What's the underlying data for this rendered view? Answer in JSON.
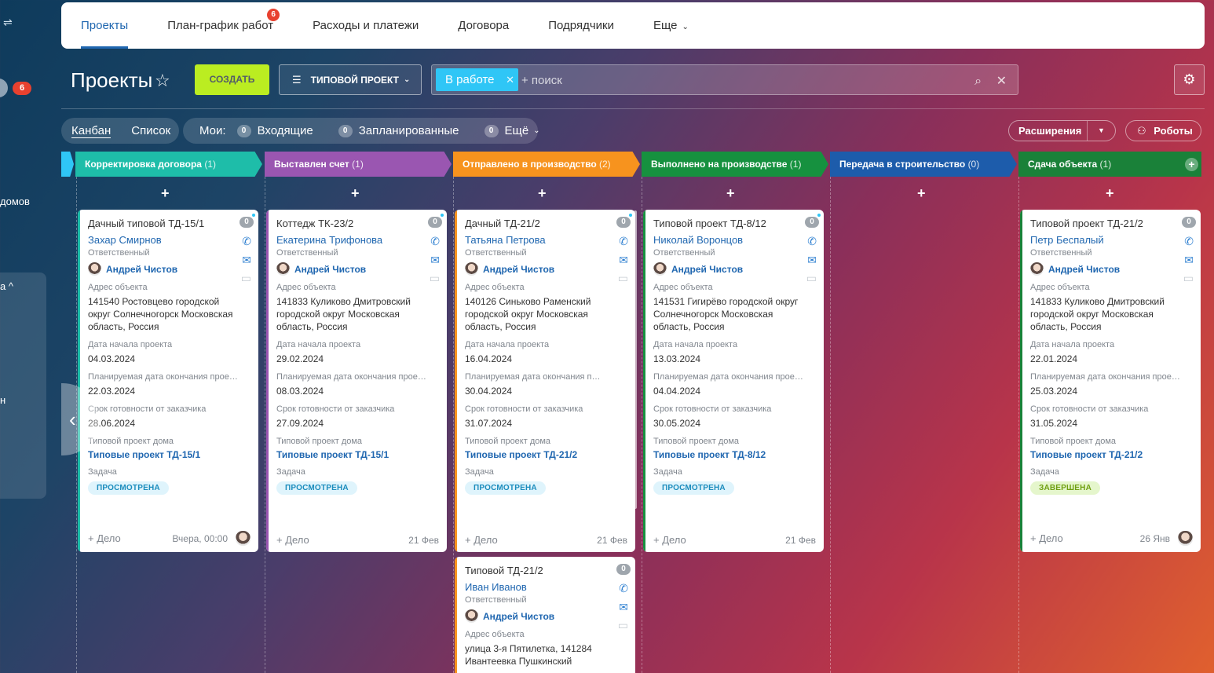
{
  "left_strip": {
    "badge": "6",
    "text1": "домов",
    "text2": "а ^",
    "text3": "н"
  },
  "topnav": {
    "tabs": [
      {
        "label": "Проекты",
        "active": true
      },
      {
        "label": "План-график работ",
        "badge": "6"
      },
      {
        "label": "Расходы и платежи"
      },
      {
        "label": "Договора"
      },
      {
        "label": "Подрядчики"
      },
      {
        "label": "Еще"
      }
    ]
  },
  "toolbar": {
    "title": "Проекты",
    "create_label": "СОЗДАТЬ",
    "preset_label": "ТИПОВОЙ ПРОЕКТ",
    "filter_chip": "В работе",
    "search_placeholder": "+ поиск"
  },
  "views": {
    "kanban": "Канбан",
    "list": "Список"
  },
  "counters": {
    "mine": "Мои:",
    "items": [
      {
        "count": "0",
        "label": "Входящие"
      },
      {
        "count": "0",
        "label": "Запланированные"
      },
      {
        "count": "0",
        "label": "Ещё"
      }
    ]
  },
  "right_buttons": {
    "extensions": "Расширения",
    "robots": "Роботы"
  },
  "stages": [
    {
      "name": "Корректировка договора",
      "count": "(1)",
      "color": "#1ebda9"
    },
    {
      "name": "Выставлен счет",
      "count": "(1)",
      "color": "#9a56b1"
    },
    {
      "name": "Отправлено в производство",
      "count": "(2)",
      "color": "#f7931e"
    },
    {
      "name": "Выполнено на производстве",
      "count": "(1)",
      "color": "#16913f"
    },
    {
      "name": "Передача в строительство",
      "count": "(0)",
      "color": "#1d5cab"
    },
    {
      "name": "Сдача объекта",
      "count": "(1)",
      "color": "#1a8139"
    }
  ],
  "labels": {
    "responsible": "Ответственный",
    "address": "Адрес объекта",
    "start": "Дата начала проекта",
    "planned_end": "Планируемая дата окончания проекта",
    "deadline": "Срок готовности от заказчика",
    "house": "Типовой проект дома",
    "task": "Задача",
    "add_deal": "+ Дело"
  },
  "cards": [
    {
      "title": "Дачный типовой ТД-15/1",
      "client": "Захар Смирнов",
      "responsible": "Андрей Чистов",
      "address": "141540 Ростовцево городской округ Солнечногорск Московская область, Россия",
      "start": "04.03.2024",
      "planned_end": "22.03.2024",
      "deadline": "28.06.2024",
      "house": "Типовые проект ТД-15/1",
      "task": "ПРОСМОТРЕНА",
      "date": "Вчера, 00:00",
      "badge": "0"
    },
    {
      "title": "Коттедж ТК-23/2",
      "client": "Екатерина Трифонова",
      "responsible": "Андрей Чистов",
      "address": "141833 Куликово Дмитровский городской округ Московская область, Россия",
      "start": "29.02.2024",
      "planned_end": "08.03.2024",
      "deadline": "27.09.2024",
      "house": "Типовые проект ТД-15/1",
      "task": "ПРОСМОТРЕНА",
      "date": "21 Фев",
      "badge": "0"
    },
    {
      "title": "Дачный ТД-21/2",
      "client": "Татьяна Петрова",
      "responsible": "Андрей Чистов",
      "address": "140126 Синьково Раменский городской округ Московская область, Россия",
      "start": "16.04.2024",
      "planned_end": "30.04.2024",
      "deadline": "31.07.2024",
      "house": "Типовые проект ТД-21/2",
      "task": "ПРОСМОТРЕНА",
      "date": "21 Фев",
      "badge": "0"
    },
    {
      "title": "Типовой проект ТД-8/12",
      "client": "Николай Воронцов",
      "responsible": "Андрей Чистов",
      "address": "141531 Гигирёво городской округ Солнечногорск Московская область, Россия",
      "start": "13.03.2024",
      "planned_end": "04.04.2024",
      "deadline": "30.05.2024",
      "house": "Типовые проект ТД-8/12",
      "task": "ПРОСМОТРЕНА",
      "date": "21 Фев",
      "badge": "0"
    },
    {
      "title": "Типовой проект ТД-21/2",
      "client": "Петр Беспалый",
      "responsible": "Андрей Чистов",
      "address": "141833 Куликово Дмитровский городской округ Московская область, Россия",
      "start": "22.01.2024",
      "planned_end": "25.03.2024",
      "deadline": "31.05.2024",
      "house": "Типовые проект ТД-21/2",
      "task": "ЗАВЕРШЕНА",
      "date": "26 Янв",
      "badge": "0"
    },
    {
      "title": "Типовой ТД-21/2",
      "client": "Иван Иванов",
      "responsible": "Андрей Чистов",
      "address": "улица 3-я Пятилетка, 141284 Ивантеевка Пушкинский",
      "badge": "0"
    }
  ]
}
